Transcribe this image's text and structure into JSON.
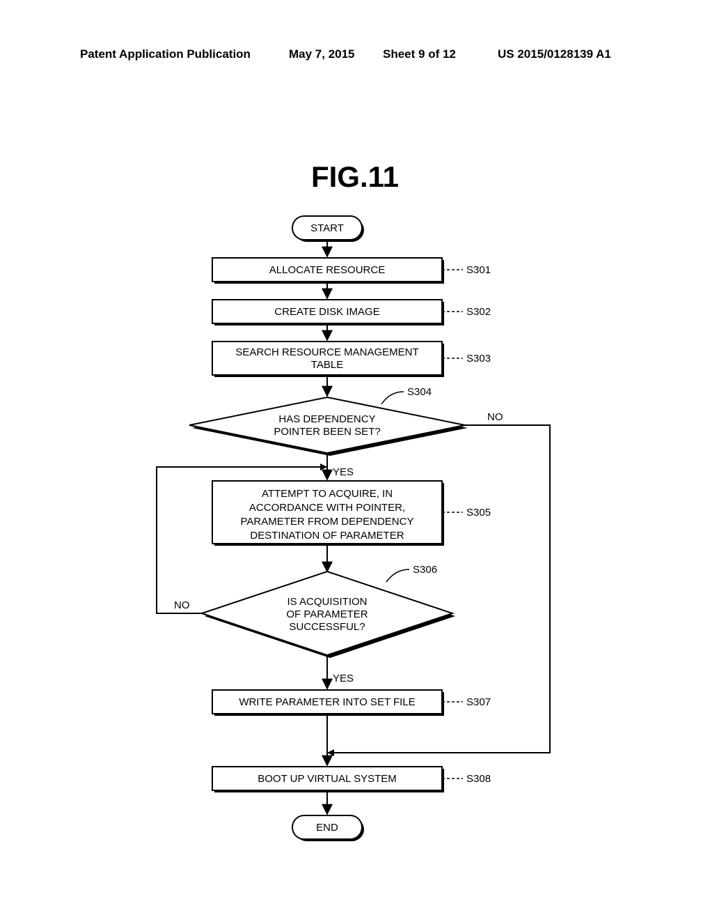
{
  "header": {
    "left": "Patent Application Publication",
    "date": "May 7, 2015",
    "sheet": "Sheet 9 of 12",
    "docnum": "US 2015/0128139 A1"
  },
  "figure": {
    "title": "FIG.11",
    "start": "START",
    "end": "END",
    "steps": {
      "s301": {
        "text": "ALLOCATE RESOURCE",
        "ref": "S301"
      },
      "s302": {
        "text": "CREATE DISK IMAGE",
        "ref": "S302"
      },
      "s303": {
        "text_l1": "SEARCH RESOURCE MANAGEMENT",
        "text_l2": "TABLE",
        "ref": "S303"
      },
      "s304": {
        "text_l1": "HAS DEPENDENCY",
        "text_l2": "POINTER BEEN SET?",
        "ref": "S304"
      },
      "s305": {
        "text_l1": "ATTEMPT TO ACQUIRE, IN",
        "text_l2": "ACCORDANCE WITH POINTER,",
        "text_l3": "PARAMETER FROM DEPENDENCY",
        "text_l4": "DESTINATION OF PARAMETER",
        "ref": "S305"
      },
      "s306": {
        "text_l1": "IS ACQUISITION",
        "text_l2": "OF PARAMETER",
        "text_l3": "SUCCESSFUL?",
        "ref": "S306"
      },
      "s307": {
        "text": "WRITE PARAMETER INTO SET FILE",
        "ref": "S307"
      },
      "s308": {
        "text": "BOOT UP VIRTUAL SYSTEM",
        "ref": "S308"
      }
    },
    "labels": {
      "yes": "YES",
      "no": "NO"
    }
  }
}
